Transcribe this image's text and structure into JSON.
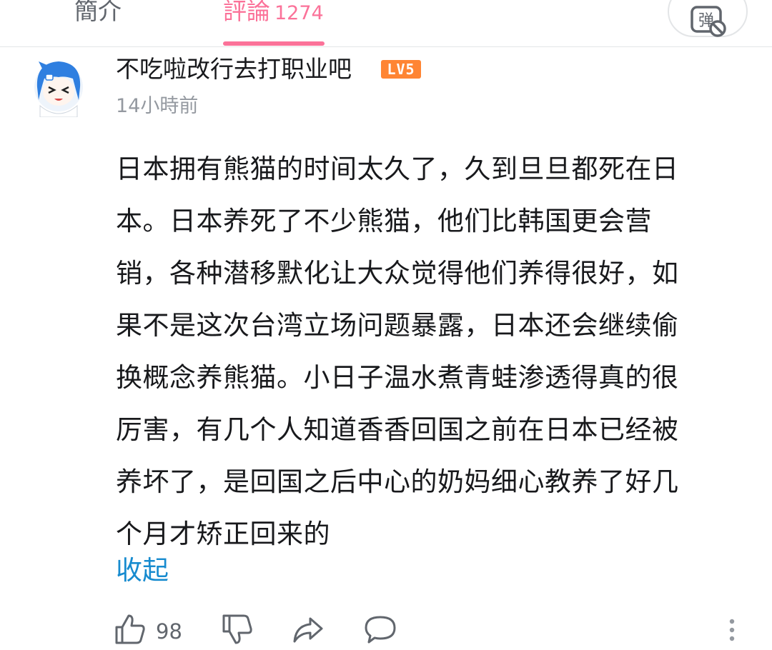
{
  "tabs": {
    "intro_label": "簡介",
    "comments_label": "評論",
    "comments_count": "1274"
  },
  "danmaku": {
    "icon": "danmaku-off-icon",
    "label": "弹"
  },
  "comment": {
    "username": "不吃啦改行去打职业吧",
    "level": "LV5",
    "timestamp": "14小時前",
    "body_lines": [
      "日本拥有熊猫的时间太久了，久到旦旦都死在日",
      "本。日本养死了不少熊猫，他们比韩国更会营",
      "销，各种潜移默化让大众觉得他们养得很好，如",
      "果不是这次台湾立场问题暴露，日本还会继续偷",
      "换概念养熊猫。小日子温水煮青蛙渗透得真的很",
      "厉害，有几个人知道香香回国之前在日本已经被",
      "养坏了，是回国之后中心的奶妈细心教养了好几",
      "个月才矫正回来的"
    ],
    "collapse_label": "收起",
    "likes": "98"
  },
  "colors": {
    "accent_pink": "#fb7299",
    "link_blue": "#178bcf",
    "level_orange": "#ff8533",
    "text_secondary": "#9499a0"
  }
}
